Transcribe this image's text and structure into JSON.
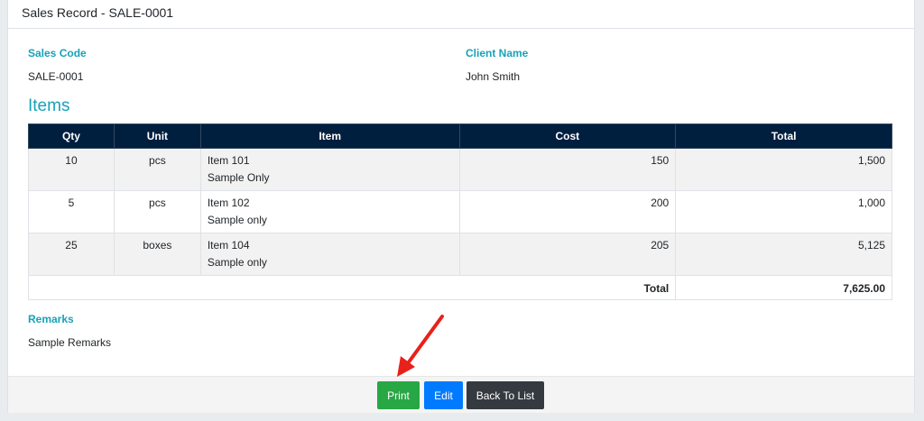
{
  "header": {
    "title": "Sales Record - SALE-0001"
  },
  "sales": {
    "code_label": "Sales Code",
    "code_value": "SALE-0001",
    "client_label": "Client Name",
    "client_value": "John Smith"
  },
  "items_title": "Items",
  "table": {
    "headers": [
      "Qty",
      "Unit",
      "Item",
      "Cost",
      "Total"
    ],
    "rows": [
      {
        "qty": "10",
        "unit": "pcs",
        "item": "Item 101",
        "desc": "Sample Only",
        "cost": "150",
        "total": "1,500"
      },
      {
        "qty": "5",
        "unit": "pcs",
        "item": "Item 102",
        "desc": "Sample only",
        "cost": "200",
        "total": "1,000"
      },
      {
        "qty": "25",
        "unit": "boxes",
        "item": "Item 104",
        "desc": "Sample only",
        "cost": "205",
        "total": "5,125"
      }
    ],
    "total_label": "Total",
    "total_value": "7,625.00"
  },
  "remarks": {
    "label": "Remarks",
    "value": "Sample Remarks"
  },
  "buttons": {
    "print": "Print",
    "edit": "Edit",
    "back": "Back To List"
  },
  "colors": {
    "accent": "#17a2b8",
    "table_header": "#001f3f",
    "print": "#28a745",
    "edit": "#007bff",
    "back": "#343a40",
    "annotation_arrow": "#e8211b"
  },
  "icons": {
    "annotation": "red-arrow-icon"
  }
}
